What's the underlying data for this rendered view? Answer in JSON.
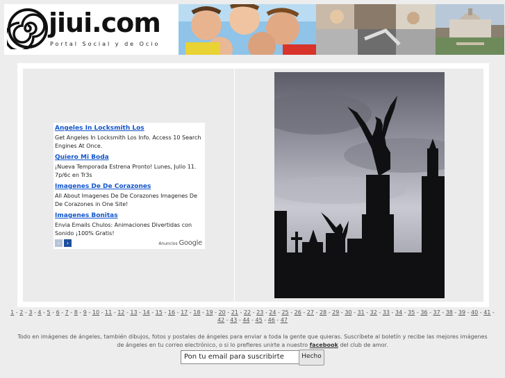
{
  "header": {
    "logo_text": "jiui.com",
    "tagline": "Portal Social y de Ocio",
    "banner_photos": [
      "children-faces",
      "hands-photo",
      "cityscape-photo"
    ]
  },
  "ads": [
    {
      "title": "Angeles In Locksmith Los",
      "desc": "Get Angeles In Locksmith Los Info. Access 10 Search Engines At Once."
    },
    {
      "title": "Quiero Mi Boda",
      "desc": "¡Nueva Temporada Estrena Pronto! Lunes, Julio 11. 7p/6c en Tr3s"
    },
    {
      "title": "Imagenes De De Corazones",
      "desc": "All About Imagenes De De Corazones Imagenes De De Corazones in One Site!"
    },
    {
      "title": "Imagenes Bonitas",
      "desc": "Envia Emails Chulos: Animaciones Divertidas con Sonido ¡100% Gratis!"
    }
  ],
  "ads_footer": {
    "prev_icon": "chevron-left-icon",
    "next_icon": "chevron-right-icon",
    "label": "Anuncios",
    "brand": "Google"
  },
  "photo": {
    "subject": "angel-statue-silhouette"
  },
  "pagination": {
    "pages": [
      "1",
      "2",
      "3",
      "4",
      "5",
      "6",
      "7",
      "8",
      "9",
      "10",
      "11",
      "12",
      "13",
      "14",
      "15",
      "16",
      "17",
      "18",
      "19",
      "20",
      "21",
      "22",
      "23",
      "24",
      "25",
      "26",
      "27",
      "28",
      "29",
      "30",
      "31",
      "32",
      "33",
      "34",
      "35",
      "36",
      "37",
      "38",
      "39",
      "40",
      "41",
      "42",
      "43",
      "44",
      "45",
      "46",
      "47"
    ],
    "separator": " - "
  },
  "footer": {
    "text_before": "Todo en imágenes de ángeles, también dibujos, fotos y postales de ángeles para enviar a toda la gente que quieras. Suscríbete al boletín y recibe las mejores imágenes de ángeles en tu correo electrónico, o si lo prefieres unirte a nuestro ",
    "link": "facebook",
    "text_after": " del club de amor."
  },
  "subscribe": {
    "input_value": "Pon tu email para suscribirte",
    "button_label": "Hecho"
  },
  "colors": {
    "link_blue": "#1155cc",
    "page_bg": "#ededed"
  }
}
